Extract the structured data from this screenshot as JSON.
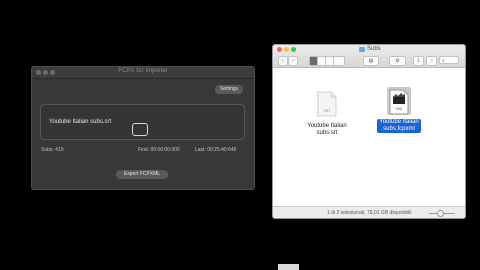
{
  "importer": {
    "title": "FCPX Srt Importer",
    "settings_label": "Settings",
    "drop_file": "Youtube Italian subs.srt",
    "subs": "Subs: 419",
    "first": "First: 00:00:00:000",
    "last": "Last: 00:25:40:646",
    "export_label": "Export FCPXML"
  },
  "finder": {
    "title": "Subs",
    "files": [
      {
        "name": "Youtube Italian subs.srt",
        "ext": "SRT",
        "selected": false
      },
      {
        "name": "Youtube Italian subs.fcpxml",
        "ext": "XML",
        "selected": true
      }
    ],
    "status": "1 di 2 selezionati, 79,01 GB disponibili"
  },
  "colors": {
    "selection": "#1b62d6",
    "finder_close": "#fc605b",
    "finder_min": "#fdbc40",
    "finder_max": "#34c84a"
  },
  "icons": [
    "back-icon",
    "forward-icon",
    "icon-view-icon",
    "list-view-icon",
    "column-view-icon",
    "gallery-view-icon",
    "arrange-icon",
    "gear-icon",
    "share-icon",
    "tag-icon",
    "search-icon",
    "folder-icon",
    "srt-file-icon",
    "fcpxml-file-icon",
    "checkbox-icon"
  ]
}
